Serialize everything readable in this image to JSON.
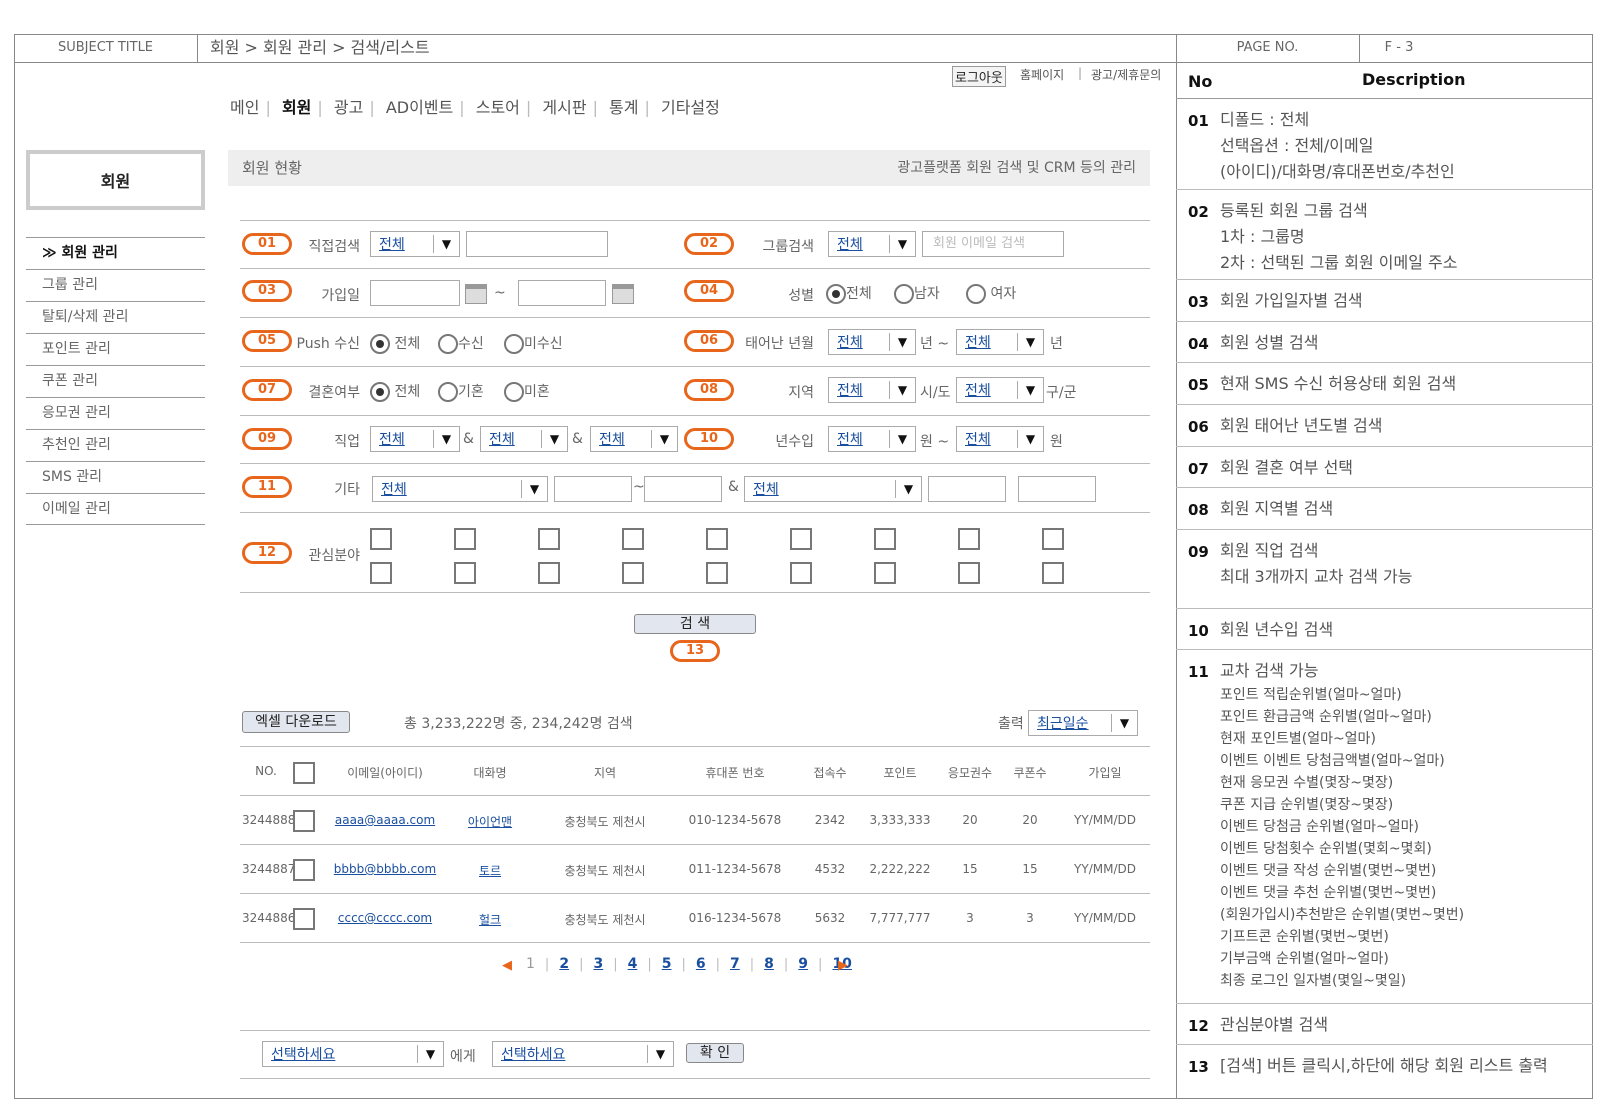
{
  "header": {
    "subject_label": "SUBJECT TITLE",
    "breadcrumb": "회원 > 회원 관리 > 검색/리스트",
    "page_label": "PAGE NO.",
    "page_no": "F - 3"
  },
  "util": {
    "logout": "로그아웃",
    "home": "홈페이지",
    "sep": "|",
    "partner": "광고/제휴문의"
  },
  "nav": {
    "items": [
      "메인",
      "회원",
      "광고",
      "AD이벤트",
      "스토어",
      "게시판",
      "통계",
      "기타설정"
    ],
    "sep": "|"
  },
  "sidebar": {
    "title": "회원",
    "items": [
      "≫ 회원 관리",
      "그룹 관리",
      "탈퇴/삭제 관리",
      "포인트 관리",
      "쿠폰 관리",
      "응모권 관리",
      "추천인 관리",
      "SMS 관리",
      "이메일 관리"
    ]
  },
  "status": {
    "left": "회원 현황",
    "right": "광고플랫폼 회원 검색 및 CRM 등의 관리"
  },
  "search": {
    "b01": "01",
    "l01": "직접검색",
    "s01": "전체",
    "b02": "02",
    "l02": "그룹검색",
    "s02": "전체",
    "p02": "회원 이메일 검색",
    "b03": "03",
    "l03": "가입일",
    "tilde": "~",
    "b04": "04",
    "l04": "성별",
    "r04": [
      "전체",
      "남자",
      "여자"
    ],
    "b05": "05",
    "l05": "Push 수신",
    "r05": [
      "전체",
      "수신",
      "미수신"
    ],
    "b06": "06",
    "l06": "태어난 년월",
    "s06a": "전체",
    "u06a": "년 ~",
    "s06b": "전체",
    "u06b": "년",
    "b07": "07",
    "l07": "결혼여부",
    "r07": [
      "전체",
      "기혼",
      "미혼"
    ],
    "b08": "08",
    "l08": "지역",
    "s08a": "전체",
    "u08a": "시/도",
    "s08b": "전체",
    "u08b": "구/군",
    "b09": "09",
    "l09": "직업",
    "s09": [
      "전체",
      "전체",
      "전체"
    ],
    "amp": "&",
    "b10": "10",
    "l10": "년수입",
    "s10a": "전체",
    "u10a": "원 ~",
    "s10b": "전체",
    "u10b": "원",
    "b11": "11",
    "l11": "기타",
    "s11a": "전체",
    "s11b": "전체",
    "b12": "12",
    "l12": "관심분야",
    "search_btn": "검 색",
    "b13": "13"
  },
  "results": {
    "excel": "엑셀 다운로드",
    "summary": "총 3,233,222명 중, 234,242명 검색",
    "sort_label": "출력",
    "sort_value": "최근일순",
    "columns": [
      "NO.",
      "이메일(아이디)",
      "대화명",
      "지역",
      "휴대폰 번호",
      "접속수",
      "포인트",
      "응모권수",
      "쿠폰수",
      "가입일"
    ],
    "rows": [
      {
        "no": "3244888",
        "email": "aaaa@aaaa.com",
        "nick": "아이언맨",
        "region": "충청북도 제천시",
        "phone": "010-1234-5678",
        "visits": "2342",
        "points": "3,333,333",
        "tickets": "20",
        "coupons": "20",
        "date": "YY/MM/DD"
      },
      {
        "no": "3244887",
        "email": "bbbb@bbbb.com",
        "nick": "토르",
        "region": "충청북도 제천시",
        "phone": "011-1234-5678",
        "visits": "4532",
        "points": "2,222,222",
        "tickets": "15",
        "coupons": "15",
        "date": "YY/MM/DD"
      },
      {
        "no": "3244886",
        "email": "cccc@cccc.com",
        "nick": "헐크",
        "region": "충청북도 제천시",
        "phone": "016-1234-5678",
        "visits": "5632",
        "points": "7,777,777",
        "tickets": "3",
        "coupons": "3",
        "date": "YY/MM/DD"
      }
    ]
  },
  "pagination": {
    "prev": "◀",
    "next": "▶",
    "pages": [
      "1",
      "2",
      "3",
      "4",
      "5",
      "6",
      "7",
      "8",
      "9",
      "10"
    ],
    "sep": "|"
  },
  "bulk": {
    "sel1": "선택하세요",
    "to": "에게",
    "sel2": "선택하세요",
    "confirm": "확 인"
  },
  "desc": {
    "col_no": "No",
    "col_desc": "Description",
    "rows": [
      {
        "no": "01",
        "lines": [
          "디폴드 : 전체",
          "선택옵션 : 전체/이메일",
          "(아이디)/대화명/휴대폰번호/추천인"
        ]
      },
      {
        "no": "02",
        "lines": [
          "등록된 회원 그룹 검색",
          "1차 : 그룹명",
          "2차 : 선택된 그룹 회원 이메일 주소"
        ]
      },
      {
        "no": "03",
        "lines": [
          "회원 가입일자별 검색"
        ]
      },
      {
        "no": "04",
        "lines": [
          "회원 성별 검색"
        ]
      },
      {
        "no": "05",
        "lines": [
          "현재 SMS 수신 허용상태 회원 검색"
        ]
      },
      {
        "no": "06",
        "lines": [
          "회원 태어난 년도별 검색"
        ]
      },
      {
        "no": "07",
        "lines": [
          "회원 결혼 여부 선택"
        ]
      },
      {
        "no": "08",
        "lines": [
          "회원 지역별 검색"
        ]
      },
      {
        "no": "09",
        "lines": [
          "회원 직업 검색",
          "최대 3개까지 교차 검색 가능"
        ]
      },
      {
        "no": "10",
        "lines": [
          "회원 년수입 검색"
        ]
      },
      {
        "no": "11",
        "lines": [
          "교차 검색 가능"
        ],
        "sub": [
          "포인트 적립순위별(얼마~얼마)",
          "포인트 환급금액 순위별(얼마~얼마)",
          "현재 포인트별(얼마~얼마)",
          "이벤트 이벤트 당첨금액별(얼마~얼마)",
          "현재 응모권 수별(몇장~몇장)",
          "쿠폰 지급 순위별(몇장~몇장)",
          "이벤트 당첨금 순위별(얼마~얼마)",
          "이벤트 당첨횟수 순위별(몇회~몇회)",
          "이벤트 댓글 작성 순위별(몇번~몇번)",
          "이벤트 댓글 추천 순위별(몇번~몇번)",
          "(회원가입시)추천받은 순위별(몇번~몇번)",
          "기프트콘 순위별(몇번~몇번)",
          "기부금액 순위별(얼마~얼마)",
          "최종 로그인 일자별(몇일~몇일)"
        ]
      },
      {
        "no": "12",
        "lines": [
          "관심분야별 검색"
        ]
      },
      {
        "no": "13",
        "lines": [
          "[검색] 버튼 클릭시,하단에 해당 회원 리스트 출력"
        ]
      }
    ]
  },
  "colors": {
    "accent": "#e8661b",
    "link": "#1a4fa0"
  }
}
